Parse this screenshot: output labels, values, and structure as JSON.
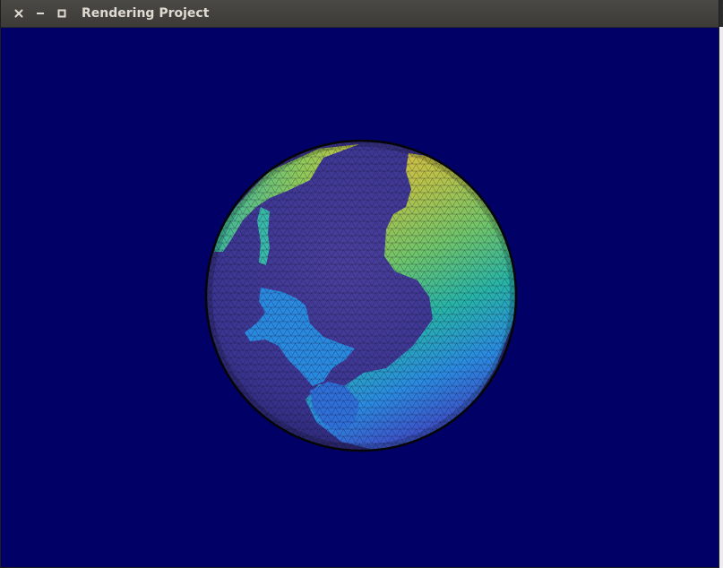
{
  "window": {
    "title": "Rendering Project"
  },
  "titlebar_buttons": {
    "close_icon": "close-icon",
    "minimize_icon": "minimize-icon",
    "maximize_icon": "maximize-icon"
  },
  "scene": {
    "object": "globe",
    "background_color": "#000066",
    "ocean_color": "#3b3591",
    "shallow_color": "#2a8ae0",
    "land_low_color": "#27b4a7",
    "land_mid_color": "#7cc463",
    "land_high_color": "#e8bb3e",
    "mesh_color": "#101010"
  }
}
